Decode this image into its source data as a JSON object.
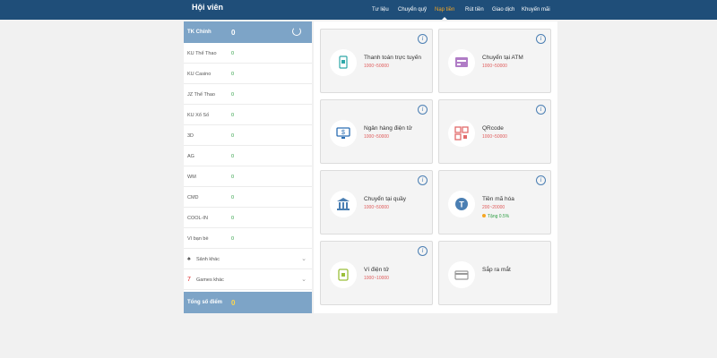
{
  "header": {
    "title": "Hội viên",
    "nav": [
      "Tư liệu",
      "Chuyển quỹ",
      "Nạp tiền",
      "Rút tiền",
      "Giao dịch",
      "Khuyến mãi"
    ],
    "active_index": 2
  },
  "sidebar": {
    "main_label": "TK Chính",
    "main_value": "0",
    "rows": [
      {
        "label": "KU Thể Thao",
        "value": "0"
      },
      {
        "label": "KU Casino",
        "value": "0"
      },
      {
        "label": "JZ Thể Thao",
        "value": "0"
      },
      {
        "label": "KU Xổ Số",
        "value": "0"
      },
      {
        "label": "3D",
        "value": "0"
      },
      {
        "label": "AG",
        "value": "0"
      },
      {
        "label": "WM",
        "value": "0"
      },
      {
        "label": "CMD",
        "value": "0"
      },
      {
        "label": "COOL-IN",
        "value": "0"
      },
      {
        "label": "Ví bạn bè",
        "value": "0"
      }
    ],
    "expand_1": "Sảnh khác",
    "expand_2": "Games khác",
    "total_label": "Tổng số điểm",
    "total_value": "0"
  },
  "cards": [
    {
      "title": "Thanh toán trực tuyến",
      "range": "1000~50000",
      "icon": "online-payment-icon"
    },
    {
      "title": "Chuyển tại ATM",
      "range": "1000~50000",
      "icon": "atm-icon"
    },
    {
      "title": "Ngân hàng điện tử",
      "range": "1000~50000",
      "icon": "e-banking-icon"
    },
    {
      "title": "QRcode",
      "range": "1000~50000",
      "icon": "qrcode-icon"
    },
    {
      "title": "Chuyển tại quầy",
      "range": "1000~50000",
      "icon": "bank-counter-icon"
    },
    {
      "title": "Tiền mã hóa",
      "range": "200~20000",
      "promo": "Tặng 0.5%",
      "icon": "crypto-icon"
    },
    {
      "title": "Ví điện tử",
      "range": "1000~10000",
      "icon": "e-wallet-icon"
    },
    {
      "title": "Sắp ra mắt",
      "icon": "card-icon"
    }
  ],
  "colors": {
    "header": "#1f4e79",
    "sidebar_accent": "#7da4c7",
    "active_nav": "#f5a623",
    "range_text": "#e05a5a",
    "value_green": "#2e9e44"
  }
}
